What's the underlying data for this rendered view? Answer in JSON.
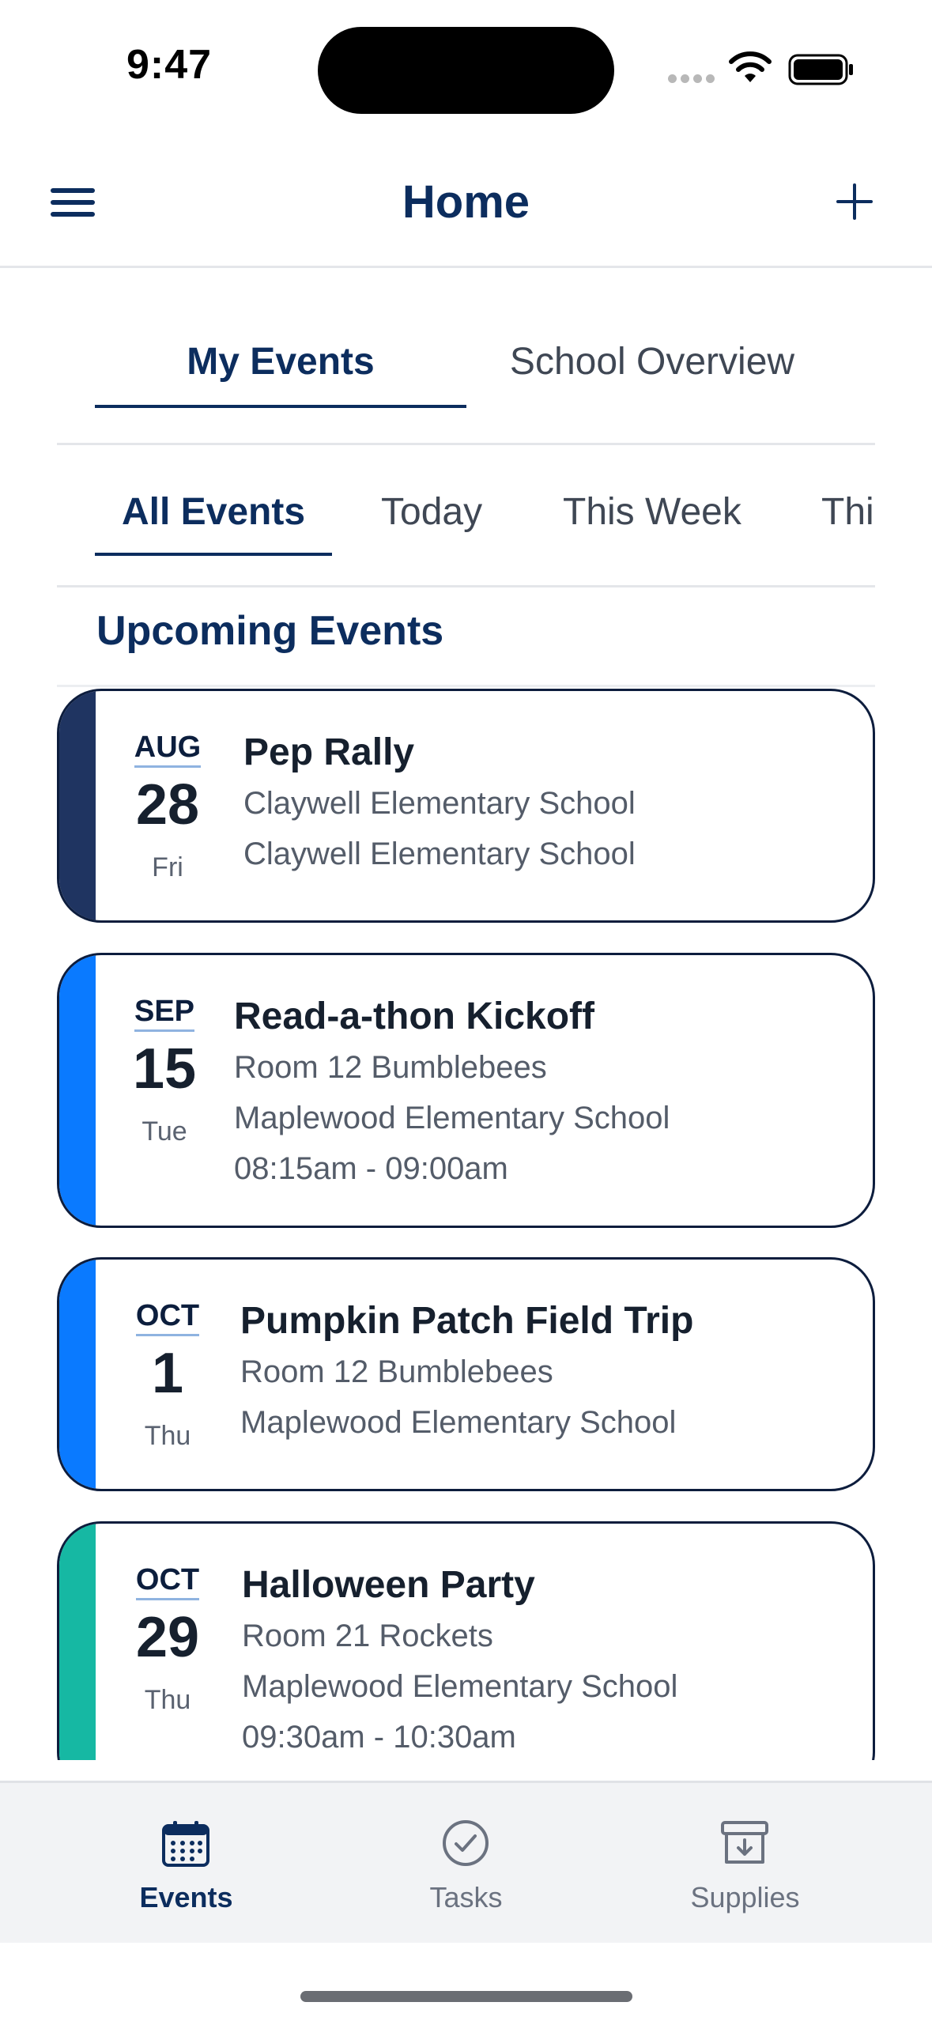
{
  "status_bar": {
    "time": "9:47"
  },
  "nav": {
    "title": "Home"
  },
  "primary_tabs": [
    {
      "label": "My Events",
      "active": true
    },
    {
      "label": "School Overview",
      "active": false
    }
  ],
  "secondary_tabs": [
    {
      "label": "All Events",
      "active": true
    },
    {
      "label": "Today",
      "active": false
    },
    {
      "label": "This Week",
      "active": false
    },
    {
      "label": "Thi",
      "active": false
    }
  ],
  "section": {
    "title": "Upcoming Events"
  },
  "events": [
    {
      "month": "AUG",
      "day": "28",
      "weekday": "Fri",
      "title": "Pep Rally",
      "line1": "Claywell Elementary School",
      "line2": "Claywell Elementary School",
      "line3": "",
      "accent": "#1f3461"
    },
    {
      "month": "SEP",
      "day": "15",
      "weekday": "Tue",
      "title": "Read-a-thon Kickoff",
      "line1": "Room 12 Bumblebees",
      "line2": "Maplewood Elementary School",
      "line3": "08:15am - 09:00am",
      "accent": "#0a7aff"
    },
    {
      "month": "OCT",
      "day": "1",
      "weekday": "Thu",
      "title": "Pumpkin Patch Field Trip",
      "line1": "Room 12 Bumblebees",
      "line2": "Maplewood Elementary School",
      "line3": "",
      "accent": "#0a7aff"
    },
    {
      "month": "OCT",
      "day": "29",
      "weekday": "Thu",
      "title": "Halloween Party",
      "line1": "Room 21 Rockets",
      "line2": "Maplewood Elementary School",
      "line3": "09:30am - 10:30am",
      "accent": "#16b8a3"
    }
  ],
  "tab_bar": [
    {
      "label": "Events",
      "icon": "calendar-icon",
      "active": true
    },
    {
      "label": "Tasks",
      "icon": "check-circle-icon",
      "active": false
    },
    {
      "label": "Supplies",
      "icon": "archive-box-icon",
      "active": false
    }
  ],
  "colors": {
    "brand": "#0c2d5e",
    "tab_bar_bg": "#f2f3f5"
  }
}
